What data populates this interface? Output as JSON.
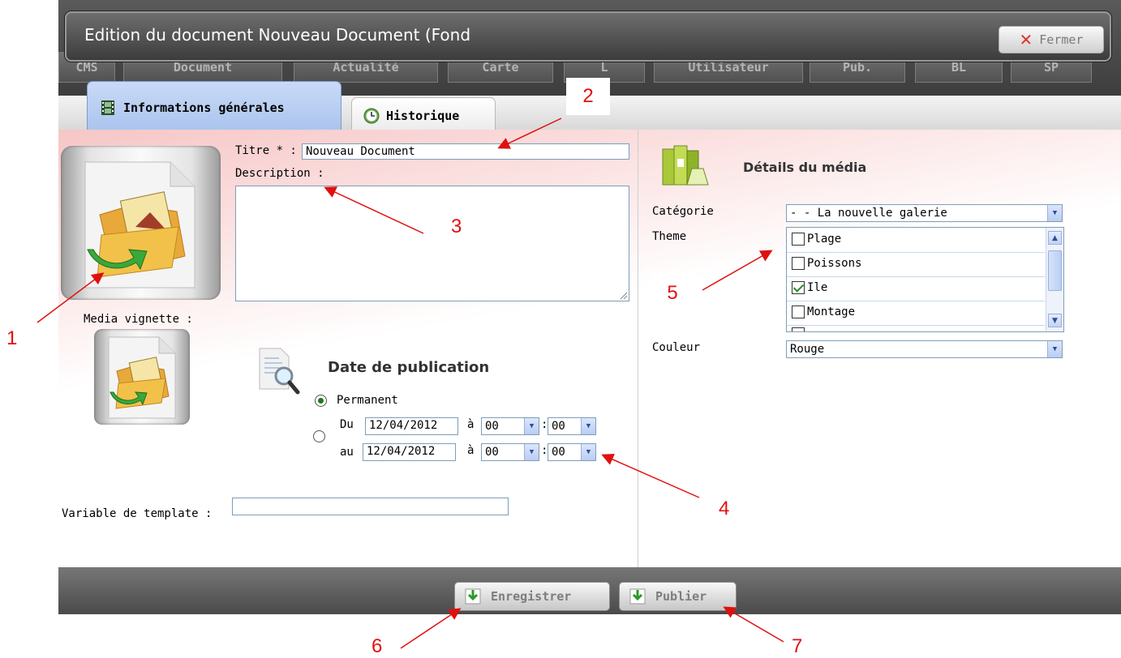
{
  "dialog": {
    "title": "Edition du document Nouveau Document (Fond",
    "close_label": "Fermer"
  },
  "background_tabs": [
    "CMS",
    "Document",
    "Actualité",
    "Carte",
    "L",
    "Utilisateur",
    "Pub.",
    "BL",
    "SP"
  ],
  "tabs": [
    {
      "label": "Informations générales",
      "active": true
    },
    {
      "label": "Historique",
      "active": false
    }
  ],
  "form": {
    "title_label": "Titre * :",
    "title_value": "Nouveau Document",
    "description_label": "Description :",
    "description_value": "",
    "vignette_label": "Media vignette :",
    "publication": {
      "heading": "Date de publication",
      "permanent_label": "Permanent",
      "from_label": "Du",
      "to_label": "au",
      "a_label": "à",
      "colon": ":",
      "from_date": "12/04/2012",
      "to_date": "12/04/2012",
      "from_hour": "00",
      "from_min": "00",
      "to_hour": "00",
      "to_min": "00",
      "selected": "permanent"
    },
    "template_label": "Variable de template :",
    "template_value": ""
  },
  "media_details": {
    "heading": "Détails du média",
    "categorie_label": "Catégorie",
    "categorie_value": "- - La nouvelle galerie",
    "theme_label": "Theme",
    "themes": [
      {
        "label": "Plage",
        "checked": false
      },
      {
        "label": "Poissons",
        "checked": false
      },
      {
        "label": "Ile",
        "checked": true
      },
      {
        "label": "Montage",
        "checked": false
      }
    ],
    "couleur_label": "Couleur",
    "couleur_value": "Rouge"
  },
  "footer": {
    "save_label": "Enregistrer",
    "publish_label": "Publier"
  },
  "callouts": [
    "1",
    "2",
    "3",
    "4",
    "5",
    "6",
    "7"
  ],
  "colors": {
    "callout": "#e01010",
    "active_tab": "#b5cdf2",
    "header": "#4a4a4a"
  }
}
